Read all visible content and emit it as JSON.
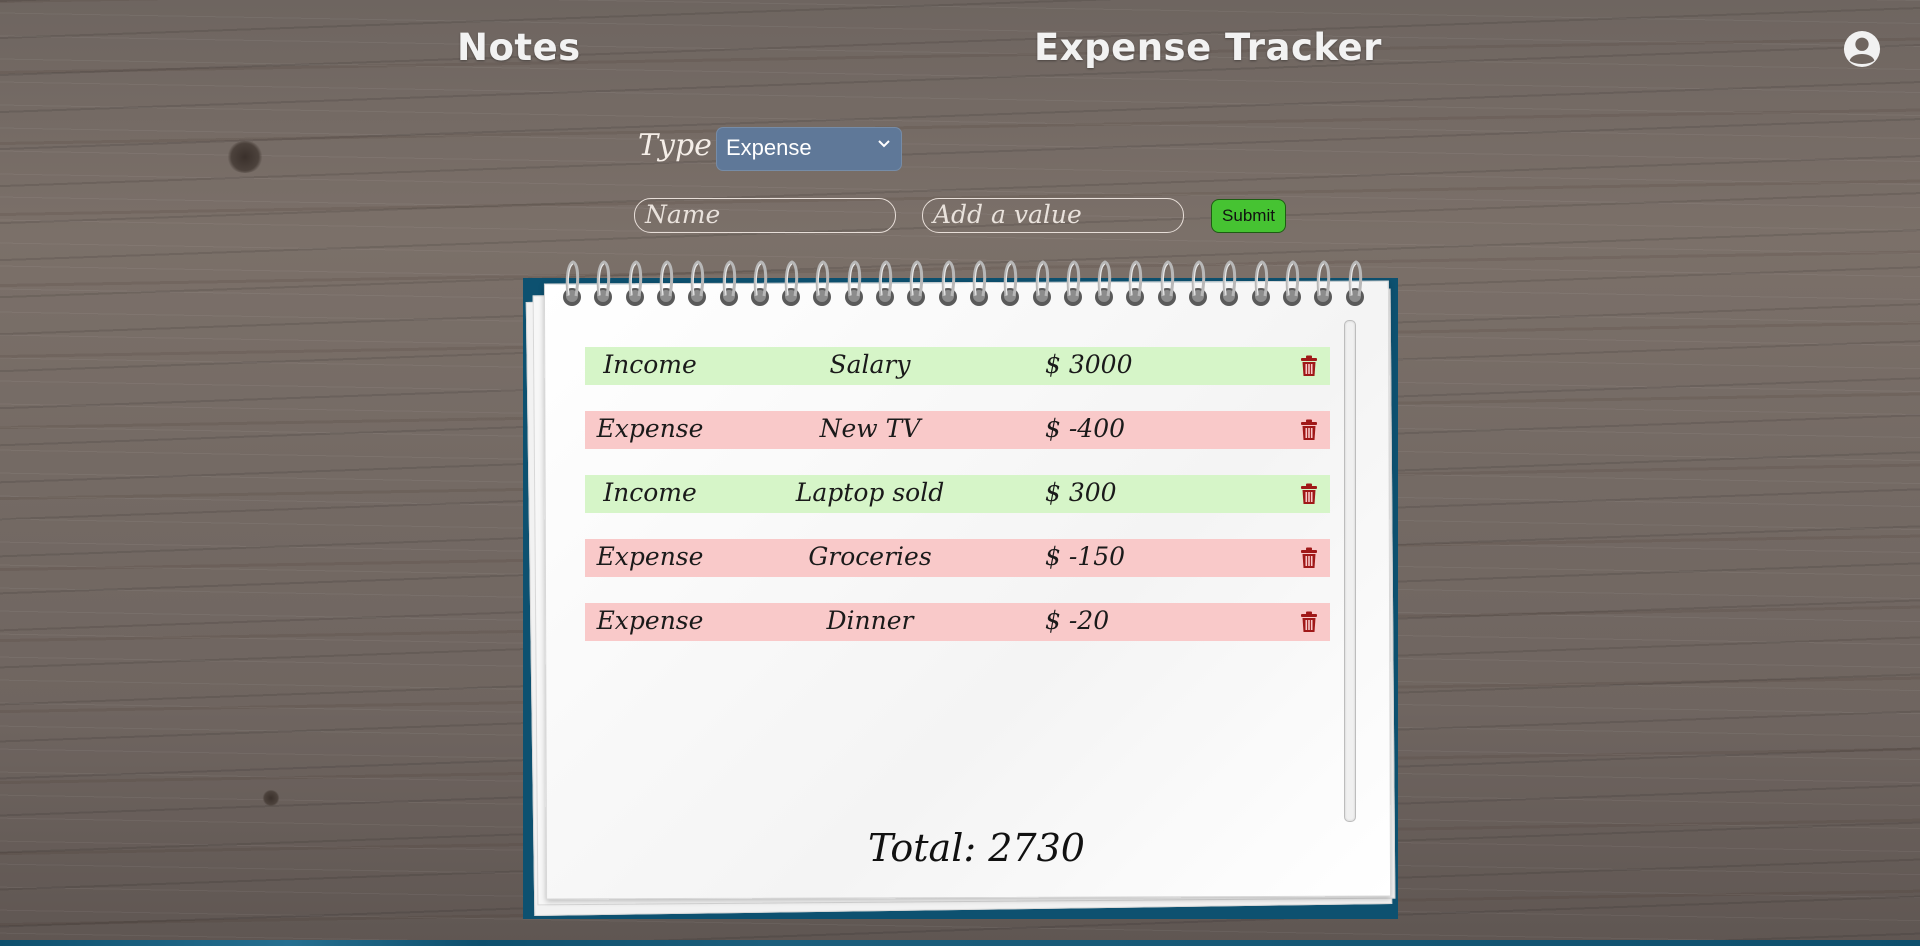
{
  "nav": {
    "notes_label": "Notes",
    "title": "Expense Tracker",
    "user_icon": "user-circle-icon"
  },
  "form": {
    "type_label": "Type",
    "type_selected": "Expense",
    "name_placeholder": "Name",
    "value_placeholder": "Add a value",
    "submit_label": "Submit"
  },
  "entries": [
    {
      "type": "Income",
      "name": "Salary",
      "amount": "$ 3000"
    },
    {
      "type": "Expense",
      "name": "New TV",
      "amount": "$ -400"
    },
    {
      "type": "Income",
      "name": "Laptop sold",
      "amount": "$ 300"
    },
    {
      "type": "Expense",
      "name": "Groceries",
      "amount": "$ -150"
    },
    {
      "type": "Expense",
      "name": "Dinner",
      "amount": "$ -20"
    }
  ],
  "total_text": "Total: 2730",
  "colors": {
    "income_row": "#d6f5c8",
    "expense_row": "#f9c9c9",
    "submit_button": "#46c332",
    "select_bg": "#5f7898",
    "notebook_cover": "#0d5170",
    "trash_icon": "#a01818"
  }
}
